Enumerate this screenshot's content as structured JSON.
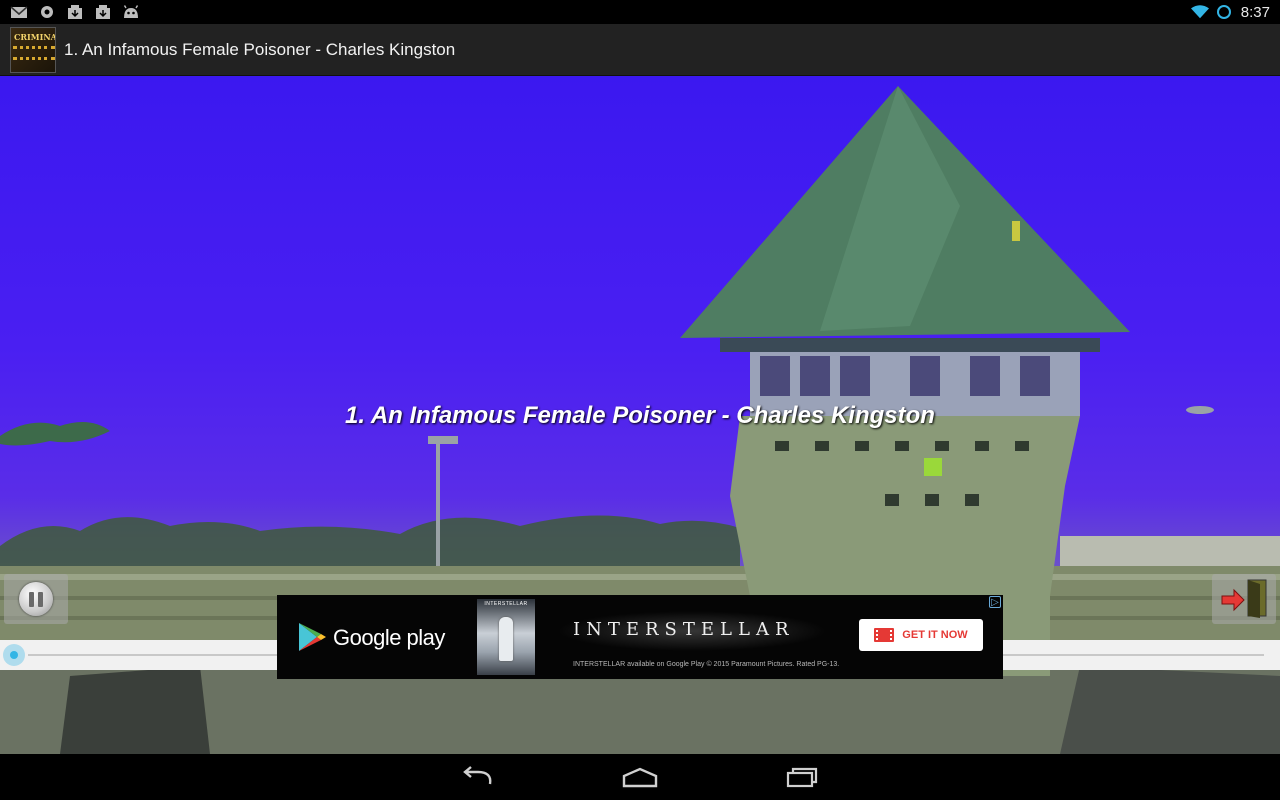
{
  "status_bar": {
    "time": "8:37",
    "icons": [
      "gmail-icon",
      "settings-icon",
      "app-update-icon",
      "app-update-icon",
      "android-icon",
      "wifi-icon",
      "sync-icon"
    ]
  },
  "action_bar": {
    "app_icon_text": "CRIMINAL",
    "title": "1. An Infamous Female Poisoner - Charles Kingston"
  },
  "player": {
    "track_title": "1. An Infamous Female Poisoner - Charles Kingston",
    "state": "playing",
    "progress": 0.0
  },
  "ad": {
    "store_label": "Google play",
    "poster_text": "INTERSTELLAR",
    "movie_title": "INTERSTELLAR",
    "fine_print": "INTERSTELLAR available on Google Play © 2015 Paramount Pictures. Rated PG-13.",
    "cta_label": "GET IT NOW",
    "adchoices": "▷"
  },
  "colors": {
    "sky": "#4a1ff2",
    "seek_accent": "#33b5e5",
    "cta_accent": "#e53935"
  }
}
